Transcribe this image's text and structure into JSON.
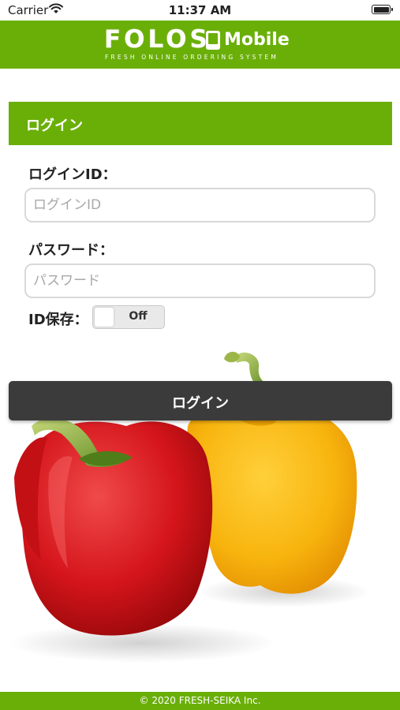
{
  "status_bar": {
    "carrier": "Carrier",
    "time": "11:37 AM",
    "icons": [
      "wifi-icon",
      "battery-icon"
    ]
  },
  "header": {
    "logo_word": "FOLOS",
    "logo_mobile": "Mobile",
    "logo_tagline": "FRESH ONLINE ORDERING SYSTEM",
    "brand_color": "#6aaf08"
  },
  "login_panel": {
    "title": "ログイン"
  },
  "form": {
    "login_id_label": "ログインID：",
    "login_id_placeholder": "ログインID",
    "login_id_value": "",
    "password_label": "パスワード：",
    "password_placeholder": "パスワード",
    "password_value": "",
    "save_id_label": "ID保存：",
    "save_id_toggle": "Off"
  },
  "login_button": {
    "label": "ログイン",
    "color": "#3b3b3b"
  },
  "footer": {
    "copyright": "© 2020 FRESH-SEIKA Inc."
  }
}
